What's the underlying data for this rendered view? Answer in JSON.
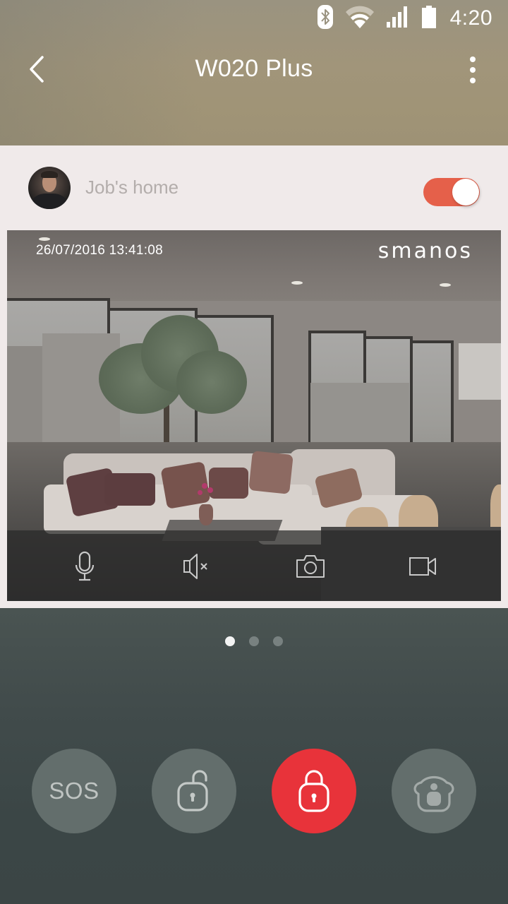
{
  "status_bar": {
    "icons": [
      "bluetooth-icon",
      "wifi-icon",
      "cellular-signal-icon",
      "battery-icon"
    ],
    "time": "4:20"
  },
  "app_bar": {
    "back_icon": "chevron-left-icon",
    "title": "W020 Plus",
    "more_icon": "more-vertical-icon"
  },
  "home": {
    "avatar": "user-avatar",
    "name": "Job's home",
    "toggle_on": true,
    "toggle_color": "#e5604a"
  },
  "camera": {
    "timestamp": "26/07/2016  13:41:08",
    "brand": "smanos",
    "controls": [
      {
        "name": "microphone",
        "icon": "microphone-icon"
      },
      {
        "name": "speaker-muted",
        "icon": "speaker-mute-icon"
      },
      {
        "name": "snapshot",
        "icon": "camera-icon"
      },
      {
        "name": "record-video",
        "icon": "video-camera-icon"
      }
    ]
  },
  "pager": {
    "count": 3,
    "active_index": 0
  },
  "actions": [
    {
      "name": "sos",
      "label": "SOS",
      "icon": "",
      "active": false
    },
    {
      "name": "disarm",
      "label": "",
      "icon": "unlocked-padlock-icon",
      "active": false
    },
    {
      "name": "arm",
      "label": "",
      "icon": "locked-padlock-icon",
      "active": true,
      "color": "#e8333a"
    },
    {
      "name": "home-arm",
      "label": "",
      "icon": "home-person-icon",
      "active": false
    }
  ]
}
